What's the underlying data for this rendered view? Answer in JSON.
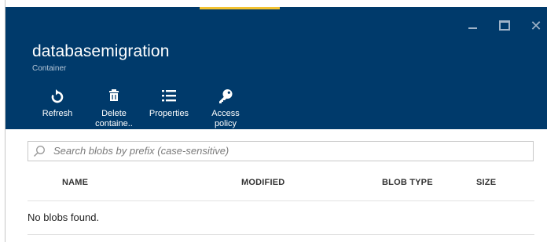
{
  "header": {
    "title": "databasemigration",
    "subtitle": "Container",
    "background": "#003a6b",
    "accent": "#f2c230"
  },
  "toolbar": [
    {
      "label": "Refresh",
      "icon": "refresh-icon"
    },
    {
      "label": "Delete\ncontaine..",
      "icon": "trash-icon"
    },
    {
      "label": "Properties",
      "icon": "list-icon"
    },
    {
      "label": "Access\npolicy",
      "icon": "key-icon"
    }
  ],
  "window_controls": [
    "minimize-icon",
    "maximize-icon",
    "close-icon"
  ],
  "search": {
    "placeholder": "Search blobs by prefix (case-sensitive)",
    "icon": "search-icon"
  },
  "table": {
    "columns": [
      "NAME",
      "MODIFIED",
      "BLOB TYPE",
      "SIZE"
    ],
    "empty_text": "No blobs found."
  }
}
